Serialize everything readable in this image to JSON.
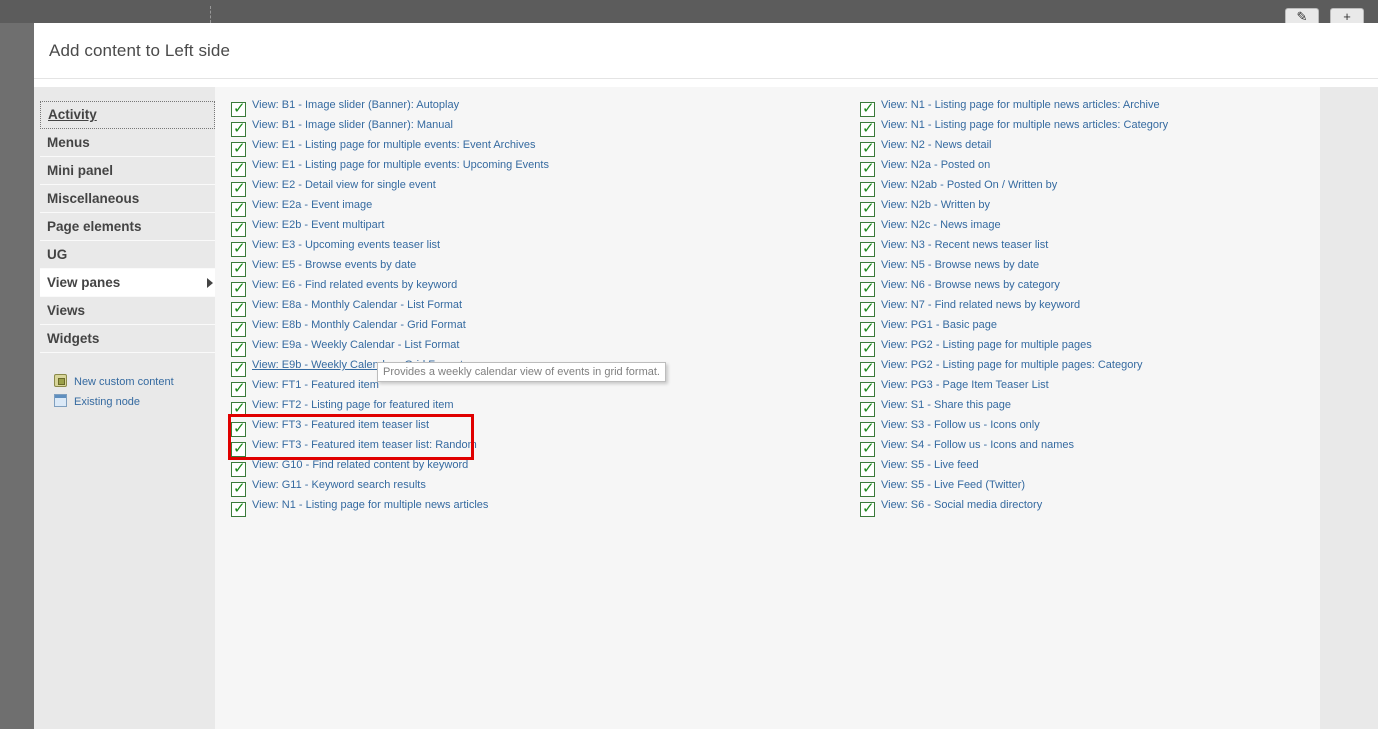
{
  "modal": {
    "title": "Add content to Left side"
  },
  "backdrop": {
    "edit_icon": "pencil-icon",
    "add_icon": "plus-icon"
  },
  "sidebar": {
    "categories": [
      {
        "label": "Activity"
      },
      {
        "label": "Menus"
      },
      {
        "label": "Mini panel"
      },
      {
        "label": "Miscellaneous"
      },
      {
        "label": "Page elements"
      },
      {
        "label": "UG"
      },
      {
        "label": "View panes",
        "active": true
      },
      {
        "label": "Views"
      },
      {
        "label": "Widgets"
      }
    ],
    "links": [
      {
        "label": "New custom content",
        "icon": "custom-content-icon"
      },
      {
        "label": "Existing node",
        "icon": "node-icon"
      }
    ]
  },
  "panes_left": [
    "View: B1 - Image slider (Banner): Autoplay",
    "View: B1 - Image slider (Banner): Manual",
    "View: E1 - Listing page for multiple events: Event Archives",
    "View: E1 - Listing page for multiple events: Upcoming Events",
    "View: E2 - Detail view for single event",
    "View: E2a - Event image",
    "View: E2b - Event multipart",
    "View: E3 - Upcoming events teaser list",
    "View: E5 - Browse events by date",
    "View: E6 - Find related events by keyword",
    "View: E8a - Monthly Calendar - List Format",
    "View: E8b - Monthly Calendar - Grid Format",
    "View: E9a - Weekly Calendar - List Format",
    "View: E9b - Weekly Calendar - Grid Format",
    "View: FT1 - Featured item",
    "View: FT2 - Listing page for featured item",
    "View: FT3 - Featured item teaser list",
    "View: FT3 - Featured item teaser list: Random",
    "View: G10 - Find related content by keyword",
    "View: G11 - Keyword search results",
    "View: N1 - Listing page for multiple news articles"
  ],
  "panes_right": [
    "View: N1 - Listing page for multiple news articles: Archive",
    "View: N1 - Listing page for multiple news articles: Category",
    "View: N2 - News detail",
    "View: N2a - Posted on",
    "View: N2ab - Posted On / Written by",
    "View: N2b - Written by",
    "View: N2c - News image",
    "View: N3 - Recent news teaser list",
    "View: N5 - Browse news by date",
    "View: N6 - Browse news by category",
    "View: N7 - Find related news by keyword",
    "View: PG1 - Basic page",
    "View: PG2 - Listing page for multiple pages",
    "View: PG2 - Listing page for multiple pages: Category",
    "View: PG3 - Page Item Teaser List",
    "View: S1 - Share this page",
    "View: S3 - Follow us - Icons only",
    "View: S4 - Follow us - Icons and names",
    "View: S5 - Live feed",
    "View: S5 - Live Feed (Twitter)",
    "View: S6 - Social media directory"
  ],
  "hovered_pane_index": 13,
  "tooltip": "Provides a weekly calendar view of events in grid format.",
  "colors": {
    "link": "#356aa0",
    "highlight": "#e00000",
    "check": "#1a8a1a"
  }
}
